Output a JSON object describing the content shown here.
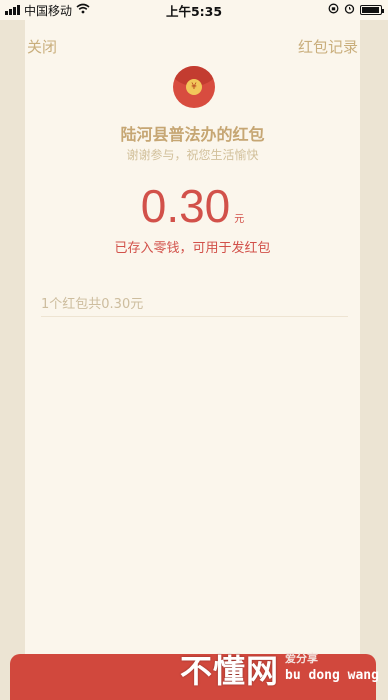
{
  "status": {
    "carrier": "中国移动",
    "time": "上午5:35",
    "signal_bars": 4,
    "battery_level": 0.95
  },
  "nav": {
    "close_label": "关闭",
    "records_label": "红包记录"
  },
  "packet": {
    "sender_title": "陆河县普法办的红包",
    "greeting": "谢谢参与，祝您生活愉快",
    "coin_symbol": "¥",
    "amount": "0.30",
    "unit": "元",
    "note": "已存入零钱，可用于发红包",
    "summary": "1个红包共0.30元"
  },
  "watermark": {
    "main": "不懂网",
    "sub": "爱分享",
    "pinyin": "bu dong wang"
  },
  "colors": {
    "accent_red": "#d2514a",
    "gold": "#c6a673",
    "background": "#fbf6ec"
  }
}
